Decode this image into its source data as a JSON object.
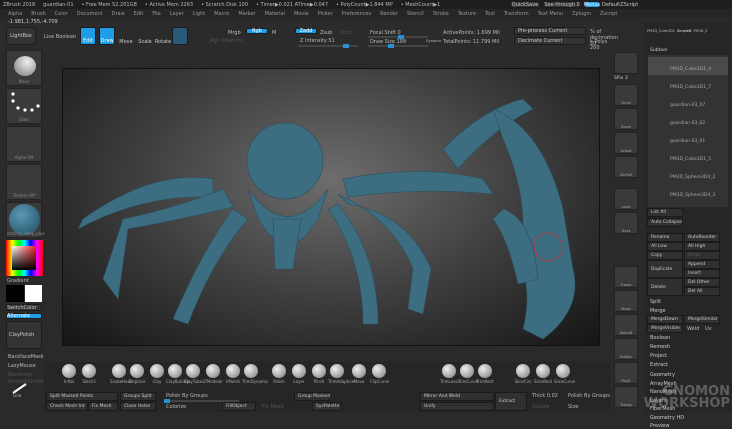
{
  "title": {
    "app": "ZBrush 2018",
    "file": "guardian-01",
    "stats": [
      "• Free Mem 52.201GB",
      "• Active Mem 2263",
      "• Scratch Disk 100",
      "• Timer▶0.021 ATime▶0.047",
      "• PolyCount▶1.844 MP",
      "• MeshCount▶1"
    ],
    "quicksave": "QuickSave",
    "see_through": "See-through 0",
    "menus": "Menus",
    "default_script": "DefaultZScript"
  },
  "menu": [
    "Alpha",
    "Brush",
    "Color",
    "Document",
    "Draw",
    "Edit",
    "File",
    "Layer",
    "Light",
    "Macro",
    "Marker",
    "Material",
    "Movie",
    "Picker",
    "Preferences",
    "Render",
    "Stencil",
    "Stroke",
    "Texture",
    "Tool",
    "Transform",
    "Text Menu",
    "Zplugin",
    "Zscript"
  ],
  "coords": "-1.981,1.755,-4.709",
  "toolbar": {
    "lightbox": "LightBox",
    "live_boolean": "Live Boolean",
    "edit": "Edit",
    "draw": "Draw",
    "move": "Move",
    "scale": "Scale",
    "rotate": "Rotate",
    "mrgb": "Mrgb",
    "rgb": "Rgb",
    "m": "M",
    "zadd": "Zadd",
    "zsub": "Zsub",
    "zcut": "Zcut",
    "rgb_intensity": "Rgb Intensity",
    "z_intensity": "Z Intensity 51",
    "focal_shift": "Focal Shift 0",
    "draw_size": "Draw Size 199",
    "dynamic": "Dynamic",
    "active_points": "ActivePoints: 1.699 Mil",
    "total_points": "TotalPoints: 11.799 Mil",
    "preprocess": "Pre-process Current",
    "decimate": "Decimate Current",
    "pct_decimation": "% of decimation 20",
    "k_polys": "k Polys 200"
  },
  "left": {
    "brush": "Move",
    "stroke": "Dots",
    "alpha": "Alpha Off",
    "texture": "Texture Off",
    "material": "matcap_deep_blue",
    "gradient": "Gradient",
    "switch_color": "SwitchColor",
    "alternate": "Alternate",
    "claypolish": "ClayPolish",
    "backface": "BackfaceMask",
    "lazymouse": "LazyMouse",
    "backtrack": "Backtrack",
    "smooth": "SmoothStroke",
    "line": "Line"
  },
  "rshelf": {
    "spix": "SPix 3",
    "items": [
      "Scroll",
      "Zoom",
      "Actual",
      "AAHalf",
      "Persp",
      "Floor",
      "Local",
      "Gxyz",
      "Frame",
      "Move",
      "ZoomD",
      "RotAte",
      "PolyF",
      "Transp",
      "Solo",
      "Ghost",
      "Xpose"
    ],
    "lineFill": "Line Fill"
  },
  "rpanel": {
    "tool_thumbs": [
      "PM3D_Cube3D1",
      "SimpleB",
      "PM3D_S"
    ],
    "subtool_title": "Subtool",
    "subtools": [
      "PM3D_Cube3D1_4",
      "PM3D_Cube3D1_7",
      "guardian-03_07",
      "guardian-03_02",
      "guardian-03_01",
      "PM3D_Cube3D1_5",
      "PM3D_Sphere3D4_2",
      "PM3D_Sphere3D4_3"
    ],
    "list_all": "List All",
    "auto_collapse": "Auto Collapse",
    "rename": "Rename",
    "autoreorder": "AutoReorder",
    "all_low": "All Low",
    "all_high": "All High",
    "copy": "Copy",
    "paste": "Paste",
    "duplicate": "Duplicate",
    "append": "Append",
    "insert": "Insert",
    "delete": "Delete",
    "del_other": "Del Other",
    "del_all": "Del All",
    "split": "Split",
    "merge": "Merge",
    "mergedown": "MergeDown",
    "mergesimilar": "MergeSimilar",
    "mergevisible": "MergeVisible",
    "weld": "Weld",
    "uv": "Uv",
    "boolean": "Boolean",
    "remesh": "Remesh",
    "project": "Project",
    "extract": "Extract",
    "sections": [
      "Geometry",
      "ArrayMesh",
      "NanoMesh",
      "Layers",
      "FiberMesh",
      "Geometry HD",
      "Preview"
    ]
  },
  "brushes": [
    "Inflat",
    "Slash3",
    "SnakeHook",
    "Displace",
    "Clay",
    "ClayBuildup",
    "ClayTubes",
    "ZModeler",
    "hPolish",
    "TrimDynamic",
    "Polish",
    "Layer",
    "Pinch",
    "TrimAdaptive",
    "Move",
    "ClipCurve",
    "TrimLasso",
    "TrimCurve",
    "TrimRect",
    "SliceCirc",
    "SliceRect",
    "SliceCurve"
  ],
  "bottom": {
    "split_masked": "Split Masked Points",
    "groups_split": "Groups Split",
    "check_mesh": "Check Mesh Int",
    "fix_mesh": "Fix Mesh",
    "close_holes": "Close Holes",
    "polish_groups": "Polish By Groups",
    "colorize": "Colorize",
    "fill_object": "FillObject",
    "group_masked": "Group Masked",
    "fix_mesh2": "Fix Mesh",
    "syspalette": "SysPalette",
    "mirror_weld": "Mirror And Weld",
    "unify": "Unify",
    "extract": "Extract",
    "thick": "Thick 0.02",
    "polish_groups2": "Polish By Groups",
    "double": "Double",
    "size": "Size"
  },
  "watermark": "THE GNOMON WORKSHOP",
  "colors": {
    "accent": "#1f9de6",
    "model": "#3f6f83"
  }
}
